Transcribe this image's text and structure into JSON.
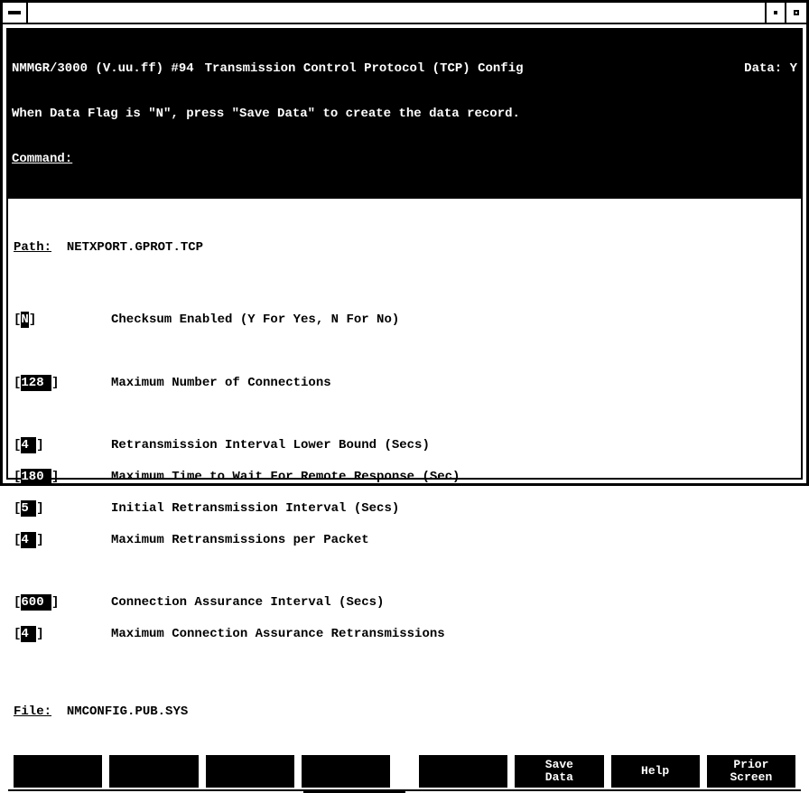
{
  "window": {
    "app_id": "NMMGR/3000 (V.uu.ff) #94",
    "screen_title": "Transmission Control Protocol (TCP) Config",
    "data_flag_label": "Data:",
    "data_flag_value": "Y",
    "hint": "When Data Flag is \"N\", press \"Save Data\" to create the data record.",
    "command_label": "Command:",
    "command_value": ""
  },
  "path": {
    "label": "Path:",
    "value": "NETXPORT.GPROT.TCP"
  },
  "fields": {
    "checksum": {
      "value": "N",
      "width": 1,
      "label": "Checksum Enabled (Y For Yes, N For No)"
    },
    "max_conn": {
      "value": "128",
      "width": 4,
      "label": "Maximum Number of Connections"
    },
    "retrans_lower": {
      "value": "4",
      "width": 2,
      "label": "Retransmission Interval Lower Bound (Secs)"
    },
    "remote_wait": {
      "value": "180",
      "width": 4,
      "label": "Maximum Time to Wait For Remote Response (Sec)"
    },
    "init_retrans": {
      "value": "5",
      "width": 2,
      "label": "Initial Retransmission Interval (Secs)"
    },
    "max_retrans": {
      "value": "4",
      "width": 2,
      "label": "Maximum Retransmissions per Packet"
    },
    "assure_int": {
      "value": "600",
      "width": 4,
      "label": "Connection Assurance Interval (Secs)"
    },
    "assure_max": {
      "value": "4",
      "width": 2,
      "label": "Maximum Connection Assurance Retransmissions"
    }
  },
  "file": {
    "label": "File:",
    "value": "NMCONFIG.PUB.SYS"
  },
  "fkeys": {
    "f1": "",
    "f2": "",
    "f3": "",
    "f4": "",
    "f5": "",
    "f6": "Save\nData",
    "f7": "Help",
    "f8": "Prior\nScreen"
  }
}
